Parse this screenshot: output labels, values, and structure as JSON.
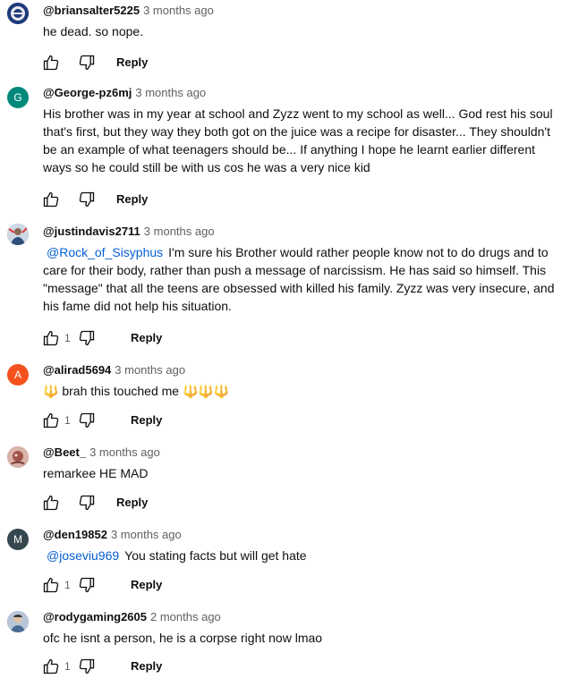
{
  "comments": [
    {
      "author": "@briansalter5225",
      "time": "3 months ago",
      "text": "he dead. so nope.",
      "likes": "",
      "reply_label": "Reply",
      "avatar": {
        "kind": "image",
        "color": "#1d3a7a"
      }
    },
    {
      "author": "@George-pz6mj",
      "time": "3 months ago",
      "text": "His brother was in my year at school and Zyzz went to my school as well... God rest his soul that's first, but they way they both got on the juice was a recipe for disaster... They shouldn't be an example of what teenagers should be... If anything I hope he learnt earlier different ways so he could still be with us cos he was a very nice kid",
      "likes": "",
      "reply_label": "Reply",
      "avatar": {
        "kind": "letter",
        "letter": "G",
        "color": "#00897b"
      }
    },
    {
      "author": "@justindavis2711",
      "time": "3 months ago",
      "mention": "@Rock_of_Sisyphus",
      "text": "I'm sure his Brother would rather people know not to do drugs and to care for their body, rather than push a message of narcissism. He has said so himself. This \"message\" that all the teens are obsessed with killed his family. Zyzz was very insecure, and his fame did not help his situation.",
      "likes": "1",
      "reply_label": "Reply",
      "avatar": {
        "kind": "image",
        "color": "#6b8fb5"
      }
    },
    {
      "author": "@alirad5694",
      "time": "3 months ago",
      "text_prefix": "🔱",
      "text": "brah this touched me",
      "text_suffix": "🔱🔱🔱",
      "likes": "1",
      "reply_label": "Reply",
      "avatar": {
        "kind": "letter",
        "letter": "A",
        "color": "#f4511e"
      }
    },
    {
      "author": "@Beet_",
      "time": "3 months ago",
      "text": "remarkee HE MAD",
      "likes": "",
      "reply_label": "Reply",
      "avatar": {
        "kind": "image",
        "color": "#c9908a"
      }
    },
    {
      "author": "@den19852",
      "time": "3 months ago",
      "mention": "@joseviu969",
      "text": "You stating facts but will get hate",
      "likes": "1",
      "reply_label": "Reply",
      "avatar": {
        "kind": "letter",
        "letter": "M",
        "color": "#37474f"
      }
    },
    {
      "author": "@rodygaming2605",
      "time": "2 months ago",
      "text": "ofc he isnt a person, he is a corpse right now lmao",
      "likes": "1",
      "reply_label": "Reply",
      "avatar": {
        "kind": "image",
        "color": "#7a8ea8"
      }
    }
  ],
  "icons": {
    "like": "thumb-up-icon",
    "dislike": "thumb-down-icon"
  }
}
